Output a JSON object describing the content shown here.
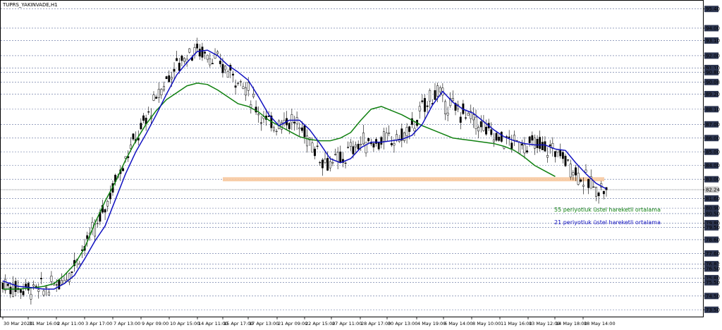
{
  "chart_data": {
    "type": "line",
    "title": "TUPRS_YAKINVADE,H1",
    "x_ticks": [
      "30 Mar 2020",
      "31 Mar 16:00",
      "2 Apr 11:00",
      "3 Apr 17:00",
      "7 Apr 13:00",
      "9 Apr 09:00",
      "10 Apr 15:00",
      "14 Apr 11:00",
      "15 Apr 17:00",
      "17 Apr 13:00",
      "21 Apr 09:00",
      "22 Apr 15:00",
      "27 Apr 11:00",
      "28 Apr 17:00",
      "30 Apr 13:00",
      "4 May 19:00",
      "6 May 14:00",
      "8 May 10:00",
      "11 May 16:00",
      "13 May 12:00",
      "14 May 18:00",
      "18 May 14:00"
    ],
    "y_ticks": [
      95.4,
      94.0,
      93.1,
      92.0,
      91.1,
      90.8,
      90.08,
      89.2,
      88.1,
      87.0,
      86.0,
      85.0,
      84.0,
      83.0,
      82.24,
      81.6,
      80.9,
      80.5,
      79.8,
      79.5,
      78.6,
      77.6,
      76.82,
      76.5,
      75.8,
      75.5,
      74.5,
      73.5
    ],
    "ylim": [
      73.0,
      96.0
    ],
    "grid": true,
    "current_price": 82.24,
    "series": [
      {
        "name": "21 periyotluk üstel hareketli ortalama",
        "color": "#1010c0",
        "values": [
          [
            0,
            75.6
          ],
          [
            6,
            75.2
          ],
          [
            12,
            75.1
          ],
          [
            16,
            75.0
          ],
          [
            20,
            75.0
          ],
          [
            24,
            75.4
          ],
          [
            28,
            76.0
          ],
          [
            32,
            77.2
          ],
          [
            36,
            78.5
          ],
          [
            40,
            79.6
          ],
          [
            44,
            81.5
          ],
          [
            48,
            83.4
          ],
          [
            52,
            85.0
          ],
          [
            56,
            86.3
          ],
          [
            60,
            87.7
          ],
          [
            64,
            89.2
          ],
          [
            68,
            90.6
          ],
          [
            72,
            91.5
          ],
          [
            76,
            92.3
          ],
          [
            80,
            92.4
          ],
          [
            84,
            92.0
          ],
          [
            88,
            91.3
          ],
          [
            92,
            90.8
          ],
          [
            96,
            90.2
          ],
          [
            100,
            89.0
          ],
          [
            104,
            87.7
          ],
          [
            108,
            86.9
          ],
          [
            112,
            87.3
          ],
          [
            116,
            87.3
          ],
          [
            120,
            86.6
          ],
          [
            124,
            85.6
          ],
          [
            128,
            84.5
          ],
          [
            132,
            84.2
          ],
          [
            136,
            84.5
          ],
          [
            140,
            85.3
          ],
          [
            144,
            85.7
          ],
          [
            148,
            85.7
          ],
          [
            152,
            85.8
          ],
          [
            156,
            85.9
          ],
          [
            160,
            86.2
          ],
          [
            164,
            87.0
          ],
          [
            168,
            88.4
          ],
          [
            172,
            89.4
          ],
          [
            176,
            88.6
          ],
          [
            180,
            88.1
          ],
          [
            184,
            87.8
          ],
          [
            188,
            87.2
          ],
          [
            192,
            86.6
          ],
          [
            196,
            86.1
          ],
          [
            200,
            85.8
          ],
          [
            204,
            85.6
          ],
          [
            208,
            85.5
          ],
          [
            212,
            85.5
          ],
          [
            216,
            85.2
          ],
          [
            220,
            85.1
          ],
          [
            224,
            84.2
          ],
          [
            228,
            83.4
          ],
          [
            232,
            82.7
          ],
          [
            236,
            82.3
          ]
        ],
        "x_range": [
          0,
          236
        ]
      },
      {
        "name": "55 periyotluk üstel hareketli ortalama",
        "color": "#108010",
        "values": [
          [
            0,
            75.0
          ],
          [
            6,
            75.0
          ],
          [
            12,
            75.1
          ],
          [
            16,
            75.2
          ],
          [
            20,
            75.4
          ],
          [
            24,
            76.0
          ],
          [
            28,
            76.8
          ],
          [
            32,
            78.0
          ],
          [
            36,
            79.8
          ],
          [
            40,
            81.4
          ],
          [
            44,
            82.8
          ],
          [
            48,
            84.4
          ],
          [
            52,
            85.8
          ],
          [
            56,
            87.0
          ],
          [
            60,
            88.0
          ],
          [
            64,
            88.8
          ],
          [
            68,
            89.3
          ],
          [
            72,
            89.8
          ],
          [
            76,
            90.0
          ],
          [
            80,
            89.9
          ],
          [
            84,
            89.5
          ],
          [
            88,
            89.0
          ],
          [
            92,
            88.5
          ],
          [
            96,
            88.3
          ],
          [
            100,
            87.9
          ],
          [
            104,
            87.3
          ],
          [
            108,
            86.9
          ],
          [
            112,
            86.5
          ],
          [
            116,
            86.1
          ],
          [
            120,
            85.9
          ],
          [
            124,
            85.8
          ],
          [
            128,
            85.8
          ],
          [
            132,
            86.0
          ],
          [
            136,
            86.4
          ],
          [
            140,
            87.3
          ],
          [
            144,
            88.1
          ],
          [
            148,
            88.3
          ],
          [
            152,
            88.0
          ],
          [
            156,
            87.7
          ],
          [
            160,
            87.3
          ],
          [
            164,
            86.9
          ],
          [
            168,
            86.6
          ],
          [
            172,
            86.3
          ],
          [
            176,
            86.0
          ],
          [
            180,
            85.9
          ],
          [
            184,
            85.8
          ],
          [
            188,
            85.7
          ],
          [
            192,
            85.6
          ],
          [
            196,
            85.4
          ],
          [
            200,
            85.1
          ],
          [
            204,
            84.6
          ],
          [
            208,
            84.0
          ],
          [
            212,
            83.6
          ],
          [
            216,
            83.2
          ]
        ],
        "x_range": [
          0,
          236
        ]
      }
    ],
    "support_zone": {
      "low": 82.85,
      "high": 83.15
    },
    "annotations": [
      {
        "text": "55 periyotluk üstel hareketli ortalama",
        "color": "#108010"
      },
      {
        "text": "21 periyotluk üstel hareketli ortalama",
        "color": "#1010c0"
      }
    ]
  }
}
